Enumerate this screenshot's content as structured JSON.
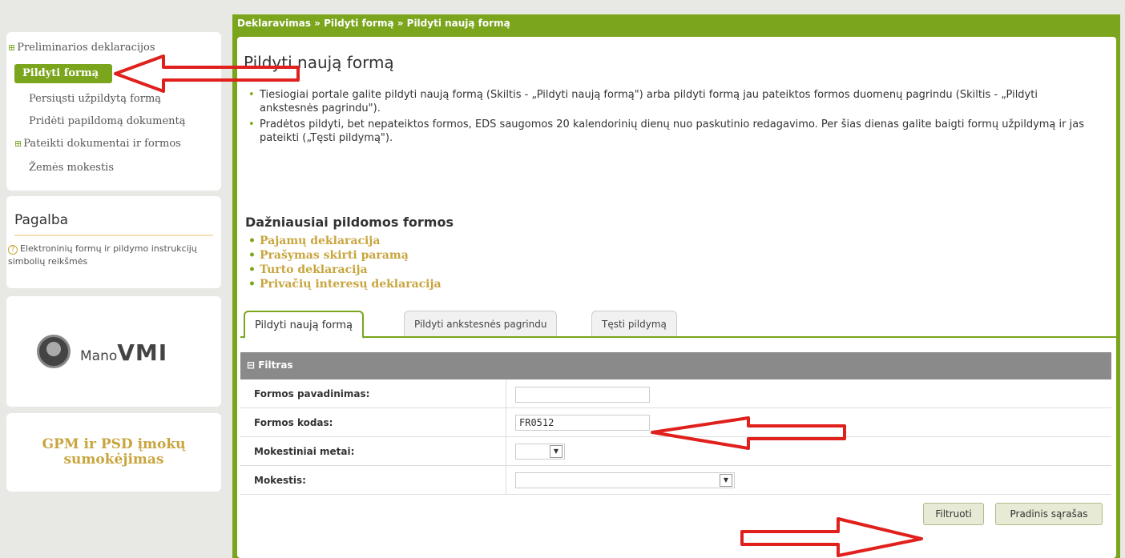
{
  "sidebar": {
    "items": [
      {
        "label": "Preliminarios deklaracijos",
        "expandable": true
      },
      {
        "label": "Pildyti formą",
        "active": true
      },
      {
        "label": "Persiųsti užpildytą formą"
      },
      {
        "label": "Pridėti papildomą dokumentą"
      },
      {
        "label": "Pateikti dokumentai ir formos",
        "expandable": true
      },
      {
        "label": "Žemės mokestis"
      }
    ]
  },
  "help": {
    "title": "Pagalba",
    "icon": "question-circle-icon",
    "text": "Elektroninių formų ir pildymo instrukcijų simbolių reikšmės"
  },
  "mano": {
    "prefix": "Mano",
    "brand": "VMI"
  },
  "gpm": {
    "line1": "GPM ir PSD įmokų",
    "line2": "sumokėjimas"
  },
  "breadcrumb": "Deklaravimas » Pildyti formą » Pildyti naują formą",
  "page_title": "Pildyti naują formą",
  "intro": [
    "Tiesiogiai portale galite pildyti naują formą (Skiltis - „Pildyti naują formą\") arba pildyti formą jau pateiktos formos duomenų pagrindu (Skiltis - „Pildyti ankstesnės pagrindu\").",
    "Pradėtos pildyti, bet nepateiktos formos, EDS saugomos 20 kalendorinių dienų nuo paskutinio redagavimo. Per šias dienas galite baigti formų užpildymą ir jas pateikti („Tęsti pildymą\")."
  ],
  "frequent": {
    "title": "Dažniausiai pildomos formos",
    "items": [
      "Pajamų deklaracija",
      "Prašymas skirti paramą",
      "Turto deklaracija",
      "Privačių interesų deklaracija"
    ]
  },
  "tabs": [
    "Pildyti naują formą",
    "Pildyti ankstesnės pagrindu",
    "Tęsti pildymą"
  ],
  "filter": {
    "title": "Filtras",
    "rows": [
      {
        "label": "Formos pavadinimas:",
        "value": ""
      },
      {
        "label": "Formos kodas:",
        "value": "FR0512"
      },
      {
        "label": "Mokestiniai metai:",
        "value": ""
      },
      {
        "label": "Mokestis:",
        "value": ""
      }
    ],
    "filter_button": "Filtruoti",
    "reset_button": "Pradinis sąrašas"
  },
  "colors": {
    "accent": "#7aa51c",
    "link": "#c8a53e",
    "annotation": "#e0201c"
  }
}
